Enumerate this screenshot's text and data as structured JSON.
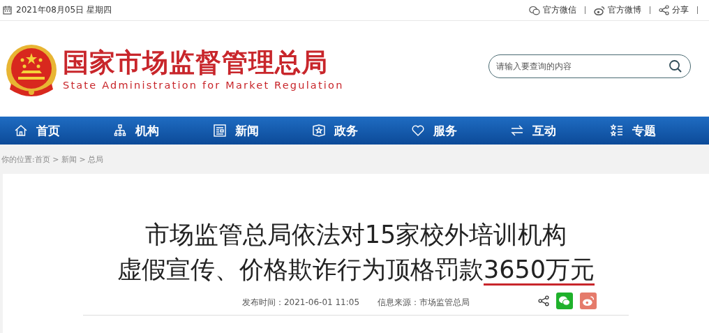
{
  "top_bar": {
    "date": "2021年08月05日 星期四",
    "links": [
      {
        "kind": "wechat",
        "label": "官方微信"
      },
      {
        "kind": "weibo",
        "label": "官方微博"
      },
      {
        "kind": "share",
        "label": "分享"
      }
    ]
  },
  "header": {
    "title": "国家市场监督管理总局",
    "subtitle": "State Administration for Market Regulation",
    "search": {
      "placeholder": "请输入要查询的内容"
    }
  },
  "nav": [
    {
      "kind": "home",
      "label": "首页"
    },
    {
      "kind": "org",
      "label": "机构"
    },
    {
      "kind": "news",
      "label": "新闻"
    },
    {
      "kind": "affairs",
      "label": "政务"
    },
    {
      "kind": "service",
      "label": "服务"
    },
    {
      "kind": "interact",
      "label": "互动"
    },
    {
      "kind": "topics",
      "label": "专题"
    }
  ],
  "breadcrumb": "你的位置:首页 > 新闻 > 总局",
  "article": {
    "title_lines": [
      {
        "text": "市场监管总局依法对15家校外培训机构"
      },
      {
        "text": "虚假宣传、价格欺诈行为顶格罚款",
        "underlined": "3650万元"
      }
    ],
    "published": "发布时间：2021-06-01 11:05",
    "source": "信息来源：市场监管总局",
    "share": [
      {
        "kind": "share"
      },
      {
        "kind": "wechat"
      },
      {
        "kind": "weibo"
      }
    ]
  }
}
